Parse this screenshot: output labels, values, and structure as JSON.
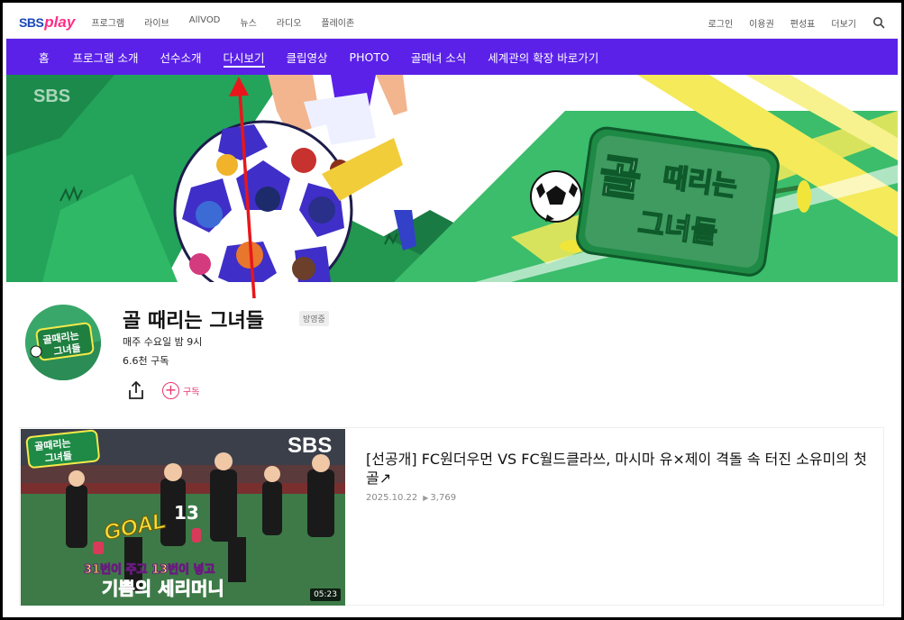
{
  "header": {
    "logo_sbs": "SBS",
    "logo_play": "play",
    "nav": [
      "프로그램",
      "라이브",
      "AllVOD",
      "뉴스",
      "라디오",
      "플레이존"
    ],
    "right": [
      "로그인",
      "이용권",
      "편성표",
      "더보기"
    ]
  },
  "main_nav": {
    "items": [
      "홈",
      "프로그램 소개",
      "선수소개",
      "다시보기",
      "클립영상",
      "PHOTO",
      "골때녀 소식",
      "세계관의 확장 바로가기"
    ],
    "active": "다시보기"
  },
  "banner": {
    "sbs_mark": "SBS",
    "logo_line1": "골",
    "logo_line2": "때리는",
    "logo_line3": "그녀들"
  },
  "channel": {
    "title": "골 때리는 그녀들",
    "badge": "방영중",
    "schedule": "매주 수요일 밤 9시",
    "subscribers": "6.6천 구독",
    "subscribe_label": "구독",
    "logo_text1": "골때리는",
    "logo_text2": "그녀들"
  },
  "video": {
    "title": "[선공개] FC원더우먼 VS FC월드클라쓰, 마시마 유×제이 격돌 속 터진 소유미의 첫 골↗",
    "date": "2025.10.22",
    "views": "3,769",
    "duration": "05:23",
    "thumb_caption1": "31번이 주고 13번이 넣고",
    "thumb_caption2": "기쁨의 세리머니",
    "thumb_goal": "GOAL",
    "thumb_sbs": "SBS",
    "thumb_logo1": "골때리는",
    "thumb_logo2": "그녀들"
  },
  "colors": {
    "nav_bg": "#5b21e8",
    "accent_pink": "#e7366e",
    "banner_green": "#1f9a54",
    "arrow_red": "#e8161b"
  }
}
